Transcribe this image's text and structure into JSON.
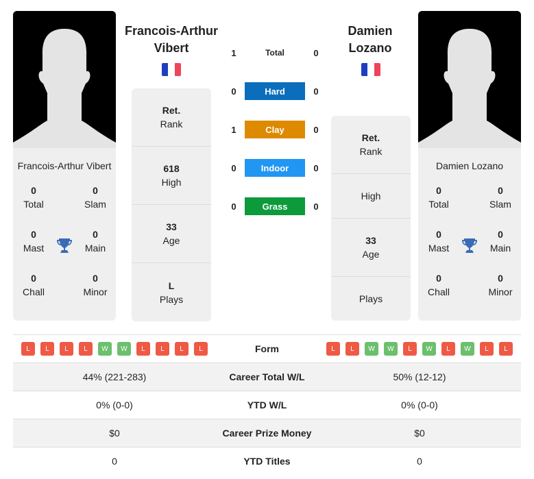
{
  "players": [
    {
      "name": "Francois-Arthur Vibert",
      "heading_line1": "Francois-Arthur",
      "heading_line2": "Vibert",
      "flag": {
        "country": "France",
        "colors": [
          "#1d3fbf",
          "#ffffff",
          "#ef4459"
        ]
      },
      "titles": {
        "total": {
          "value": "0",
          "label": "Total"
        },
        "slam": {
          "value": "0",
          "label": "Slam"
        },
        "mast": {
          "value": "0",
          "label": "Mast"
        },
        "main": {
          "value": "0",
          "label": "Main"
        },
        "chall": {
          "value": "0",
          "label": "Chall"
        },
        "minor": {
          "value": "0",
          "label": "Minor"
        }
      },
      "info": [
        {
          "value": "Ret.",
          "label": "Rank"
        },
        {
          "value": "618",
          "label": "High"
        },
        {
          "value": "33",
          "label": "Age"
        },
        {
          "value": "L",
          "label": "Plays"
        }
      ],
      "form": [
        "L",
        "L",
        "L",
        "L",
        "W",
        "W",
        "L",
        "L",
        "L",
        "L"
      ]
    },
    {
      "name": "Damien Lozano",
      "heading_line1": "Damien",
      "heading_line2": "Lozano",
      "flag": {
        "country": "France",
        "colors": [
          "#1d3fbf",
          "#ffffff",
          "#ef4459"
        ]
      },
      "titles": {
        "total": {
          "value": "0",
          "label": "Total"
        },
        "slam": {
          "value": "0",
          "label": "Slam"
        },
        "mast": {
          "value": "0",
          "label": "Mast"
        },
        "main": {
          "value": "0",
          "label": "Main"
        },
        "chall": {
          "value": "0",
          "label": "Chall"
        },
        "minor": {
          "value": "0",
          "label": "Minor"
        }
      },
      "info": [
        {
          "value": "Ret.",
          "label": "Rank"
        },
        {
          "value": "",
          "label": "High"
        },
        {
          "value": "33",
          "label": "Age"
        },
        {
          "value": "",
          "label": "Plays"
        }
      ],
      "form": [
        "L",
        "L",
        "W",
        "W",
        "L",
        "W",
        "L",
        "W",
        "L",
        "L"
      ]
    }
  ],
  "h2h": [
    {
      "label": "Total",
      "left": "1",
      "right": "0",
      "color": ""
    },
    {
      "label": "Hard",
      "left": "0",
      "right": "0",
      "color": "#0a6ebd"
    },
    {
      "label": "Clay",
      "left": "1",
      "right": "0",
      "color": "#dd8a00"
    },
    {
      "label": "Indoor",
      "left": "0",
      "right": "0",
      "color": "#2196f3"
    },
    {
      "label": "Grass",
      "left": "0",
      "right": "0",
      "color": "#0c9a3b"
    }
  ],
  "form_colors": {
    "W": "#6cbf6c",
    "L": "#ee5a45"
  },
  "trophy_color": "#3a6cb5",
  "stats": {
    "form_label": "Form",
    "rows": [
      {
        "label": "Career Total W/L",
        "left": "44% (221-283)",
        "right": "50% (12-12)"
      },
      {
        "label": "YTD W/L",
        "left": "0% (0-0)",
        "right": "0% (0-0)"
      },
      {
        "label": "Career Prize Money",
        "left": "$0",
        "right": "$0"
      },
      {
        "label": "YTD Titles",
        "left": "0",
        "right": "0"
      }
    ]
  }
}
